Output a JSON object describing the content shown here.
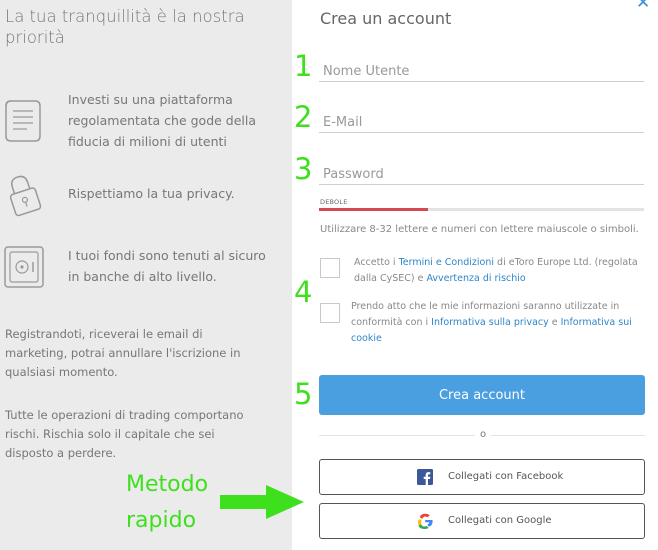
{
  "left": {
    "title": "La tua tranquillità è la nostra priorità",
    "features": [
      {
        "text": "Investi su una piattaforma regolamentata che gode della fiducia di milioni di utenti",
        "icon": "document-icon"
      },
      {
        "text": "Rispettiamo la tua privacy.",
        "icon": "padlock-icon"
      },
      {
        "text": "I tuoi fondi sono tenuti al sicuro in banche di alto livello.",
        "icon": "safe-icon"
      }
    ],
    "notes": [
      "Registrandoti, riceverai le email di marketing, potrai annullare l'iscrizione in qualsiasi momento.",
      "Tutte le operazioni di trading comportano rischi. Rischia solo il capitale che sei disposto a perdere."
    ]
  },
  "form": {
    "title": "Crea un account",
    "username_placeholder": "Nome Utente",
    "email_placeholder": "E-Mail",
    "password_placeholder": "Password",
    "strength_label": "DEBOLE",
    "password_hint": "Utilizzare 8-32 lettere e numeri con lettere maiuscole o simboli.",
    "terms": {
      "prefix": "Accetto i ",
      "link1": "Termini e Condizioni",
      "middle": " di eToro Europe Ltd. (regolata dalla CySEC) e ",
      "link2": "Avvertenza di rischio"
    },
    "privacy": {
      "prefix": "Prendo atto che le mie informazioni saranno utilizzate in conformità con i ",
      "link1": "Informativa sulla privacy",
      "middle": " e ",
      "link2": "Informativa sui cookie"
    },
    "submit_label": "Crea account",
    "divider_text": "o",
    "facebook_label": "Collegati con Facebook",
    "google_label": "Collegati con Google",
    "close_symbol": "✕"
  },
  "annotations": {
    "steps": [
      "1",
      "2",
      "3",
      "4",
      "5"
    ],
    "quick_method": "Metodo\nrapido"
  },
  "colors": {
    "accent": "#4a9fe0",
    "link": "#2e86c9",
    "annotation_green": "#3ee01d",
    "strength_weak": "#d44a52"
  }
}
